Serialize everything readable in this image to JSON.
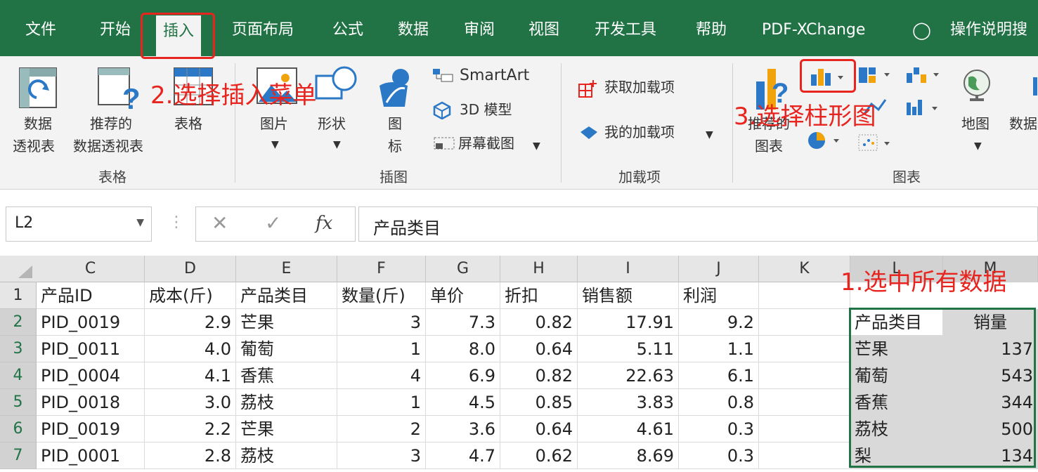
{
  "menu": {
    "tabs": [
      "文件",
      "开始",
      "插入",
      "页面布局",
      "公式",
      "数据",
      "审阅",
      "视图",
      "开发工具",
      "帮助",
      "PDF-XChange"
    ],
    "tell_me": "操作说明搜"
  },
  "ribbon": {
    "pivot_label_1": "数据",
    "pivot_label_2": "透视表",
    "rec_pivot_label_1": "推荐的",
    "rec_pivot_label_2": "数据透视表",
    "table_label": "表格",
    "pictures_label": "图片",
    "shapes_label": "形状",
    "icons_label_1": "图",
    "icons_label_2": "标",
    "smartart_label": "SmartArt",
    "model3d_label": "3D 模型",
    "screenshot_label": "屏幕截图",
    "get_addins_label": "获取加载项",
    "my_addins_label": "我的加载项",
    "rec_charts_label_1": "推荐的",
    "rec_charts_label_2": "图表",
    "map_label": "地图",
    "pivotchart_label": "数据",
    "groups": {
      "tables": "表格",
      "illustrations": "插图",
      "addins": "加载项",
      "charts": "图表"
    }
  },
  "annotations": {
    "step1": "1.选中所有数据",
    "step2": "2.选择插入菜单",
    "step3": "3.选择柱形图"
  },
  "formula_bar": {
    "name_box": "L2",
    "fx": "fx",
    "value": "产品类目"
  },
  "sheet": {
    "columns": [
      "C",
      "D",
      "E",
      "F",
      "G",
      "H",
      "I",
      "J",
      "K",
      "L",
      "M"
    ],
    "row_numbers": [
      "1",
      "2",
      "3",
      "4",
      "5",
      "6",
      "7"
    ],
    "headers": [
      "产品ID",
      "成本(斤)",
      "产品类目",
      "数量(斤)",
      "单价",
      "折扣",
      "销售额",
      "利润"
    ],
    "rows": [
      [
        "PID_0019",
        "2.9",
        "芒果",
        "3",
        "7.3",
        "0.82",
        "17.91",
        "9.2"
      ],
      [
        "PID_0011",
        "4.0",
        "葡萄",
        "1",
        "8.0",
        "0.64",
        "5.11",
        "1.1"
      ],
      [
        "PID_0004",
        "4.1",
        "香蕉",
        "4",
        "6.9",
        "0.82",
        "22.63",
        "6.1"
      ],
      [
        "PID_0018",
        "3.0",
        "荔枝",
        "1",
        "4.5",
        "0.85",
        "3.83",
        "0.8"
      ],
      [
        "PID_0019",
        "2.2",
        "芒果",
        "2",
        "3.6",
        "0.64",
        "4.61",
        "0.3"
      ],
      [
        "PID_0001",
        "2.8",
        "荔枝",
        "3",
        "4.7",
        "0.62",
        "8.69",
        "0.3"
      ]
    ],
    "side_table": {
      "headers": [
        "产品类目",
        "销量"
      ],
      "rows": [
        [
          "芒果",
          "137"
        ],
        [
          "葡萄",
          "543"
        ],
        [
          "香蕉",
          "344"
        ],
        [
          "荔枝",
          "500"
        ],
        [
          "梨",
          "134"
        ]
      ]
    }
  },
  "colors": {
    "brand": "#217346",
    "annotation": "#e8241f"
  }
}
